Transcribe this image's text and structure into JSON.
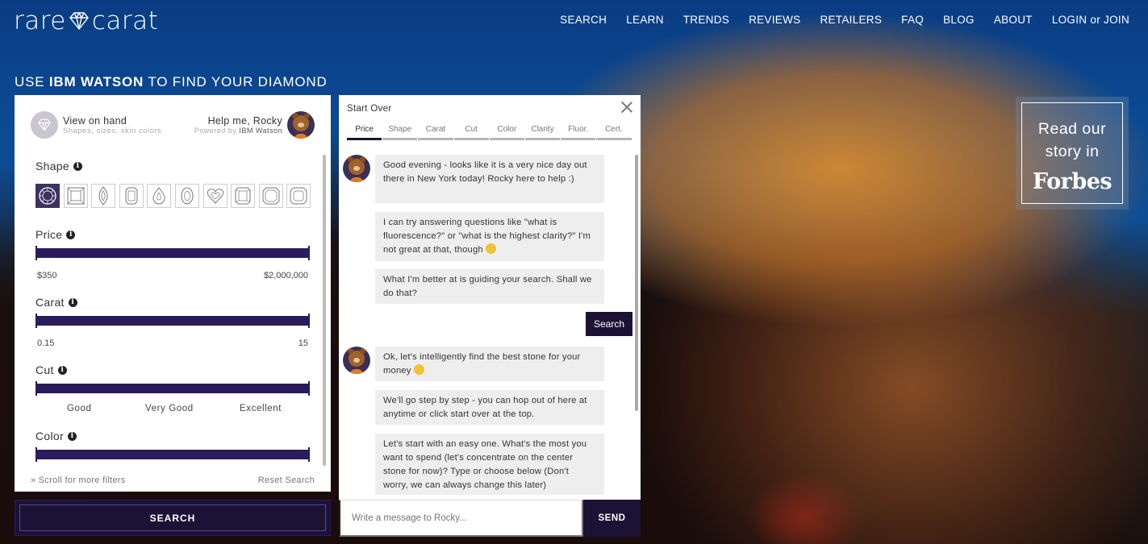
{
  "brand": {
    "logo_left": "rare",
    "logo_right": "carat"
  },
  "nav": [
    "SEARCH",
    "LEARN",
    "TRENDS",
    "REVIEWS",
    "RETAILERS",
    "FAQ",
    "BLOG",
    "ABOUT",
    "LOGIN or JOIN"
  ],
  "headline": {
    "pre": "USE ",
    "bold": "IBM WATSON",
    "post": " TO FIND YOUR DIAMOND"
  },
  "filters": {
    "onhand_title": "View on hand",
    "onhand_sub": "Shapes, sizes, skin colors",
    "rocky_title": "Help me, Rocky",
    "rocky_powered": "Powered by",
    "rocky_brand": "IBM Watson",
    "shape_label": "Shape",
    "shape_icons": [
      "round-icon",
      "princess-icon",
      "marquise-icon",
      "emerald-icon",
      "pear-icon",
      "oval-icon",
      "heart-icon",
      "radiant-icon",
      "asscher-icon",
      "cushion-icon"
    ],
    "price_label": "Price",
    "price_min": "$350",
    "price_max": "$2,000,000",
    "carat_label": "Carat",
    "carat_min": "0.15",
    "carat_max": "15",
    "cut_label": "Cut",
    "cut_options": [
      "Good",
      "Very Good",
      "Excellent"
    ],
    "color_label": "Color",
    "scroll_more": "Scroll for more filters",
    "reset": "Reset Search"
  },
  "search_button": "SEARCH",
  "chat": {
    "start_over": "Start Over",
    "steps": [
      "Price",
      "Shape",
      "Carat",
      "Cut",
      "Color",
      "Clarity",
      "Fluor.",
      "Cert."
    ],
    "active_step": "Price",
    "messages": [
      "Good evening - looks like it is a very nice day out there in New York today! Rocky here to help :)",
      "I can try answering questions like \"what is fluorescence?\" or \"what is the highest clarity?\" I'm not great at that, though",
      "What I'm better at is guiding your search. Shall we do that?",
      "Ok, let's intelligently find the best stone for your money",
      "We'll go step by step - you can hop out of here at anytime or click start over at the top.",
      "Let's start with an easy one. What's the most you want to spend (let's concentrate on the center stone for now)? Type or choose below (Don't worry, we can always change this later)"
    ],
    "user_reply": "Search",
    "input_placeholder": "Write a message to Rocky...",
    "send": "SEND"
  },
  "forbes": {
    "line1": "Read our",
    "line2": "story in",
    "brand": "Forbes"
  }
}
